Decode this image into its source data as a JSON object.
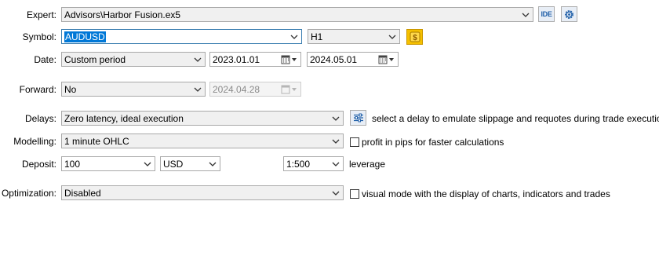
{
  "labels": {
    "expert": "Expert:",
    "symbol": "Symbol:",
    "date": "Date:",
    "forward": "Forward:",
    "delays": "Delays:",
    "modelling": "Modelling:",
    "deposit": "Deposit:",
    "optimization": "Optimization:"
  },
  "expert": {
    "value": "Advisors\\Harbor Fusion.ex5",
    "ide_label": "IDE"
  },
  "symbol": {
    "value": "AUDUSD",
    "timeframe": "H1",
    "symbol_icon": "dollar-coin-icon"
  },
  "date": {
    "period": "Custom period",
    "from": "2023.01.01",
    "to": "2024.05.01"
  },
  "forward": {
    "value": "No",
    "date": "2024.04.28"
  },
  "delays": {
    "value": "Zero latency, ideal execution",
    "hint": "select a delay to emulate slippage and requotes during trade execution"
  },
  "modelling": {
    "value": "1 minute OHLC",
    "checkbox_label": "profit in pips for faster calculations",
    "checked": false
  },
  "deposit": {
    "amount": "100",
    "currency": "USD",
    "leverage": "1:500",
    "leverage_label": "leverage"
  },
  "optimization": {
    "value": "Disabled",
    "checkbox_label": "visual mode with the display of charts, indicators and trades",
    "checked": false
  },
  "colors": {
    "selection": "#0078d7",
    "focus_border": "#3c7fb1",
    "icon_blue": "#1f5fa8",
    "coin_yellow": "#f5c000"
  }
}
